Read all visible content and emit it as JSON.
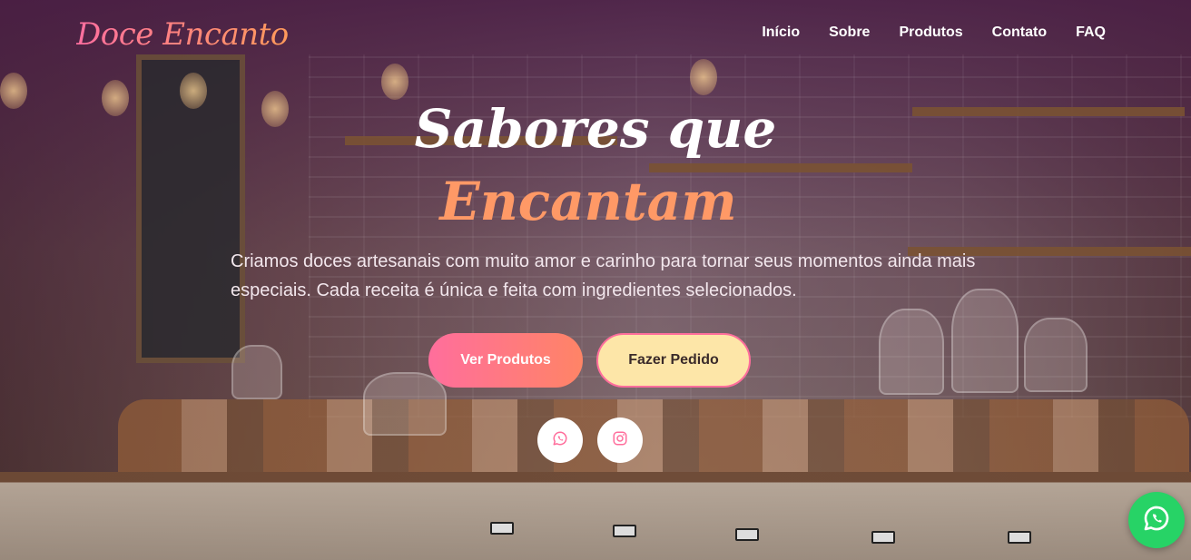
{
  "brand": {
    "logo_text": "Doce Encanto"
  },
  "nav": {
    "items": [
      {
        "label": "Início"
      },
      {
        "label": "Sobre"
      },
      {
        "label": "Produtos"
      },
      {
        "label": "Contato"
      },
      {
        "label": "FAQ"
      }
    ]
  },
  "hero": {
    "title_line1": "Sabores que",
    "title_line2": "Encantam",
    "description": "Criamos doces artesanais com muito amor e carinho para tornar seus momentos ainda mais especiais. Cada receita é única e feita com ingredientes selecionados.",
    "primary_button": "Ver Produtos",
    "secondary_button": "Fazer Pedido"
  },
  "social": {
    "items": [
      {
        "icon": "whatsapp-icon"
      },
      {
        "icon": "instagram-icon"
      }
    ]
  },
  "floating_button": {
    "icon": "whatsapp-icon"
  },
  "colors": {
    "accent_pink": "#ff6e9c",
    "accent_orange": "#ff9966",
    "secondary_button_bg": "#fde6a8",
    "whatsapp_green": "#27d366",
    "nav_overlay": "#481c44"
  }
}
